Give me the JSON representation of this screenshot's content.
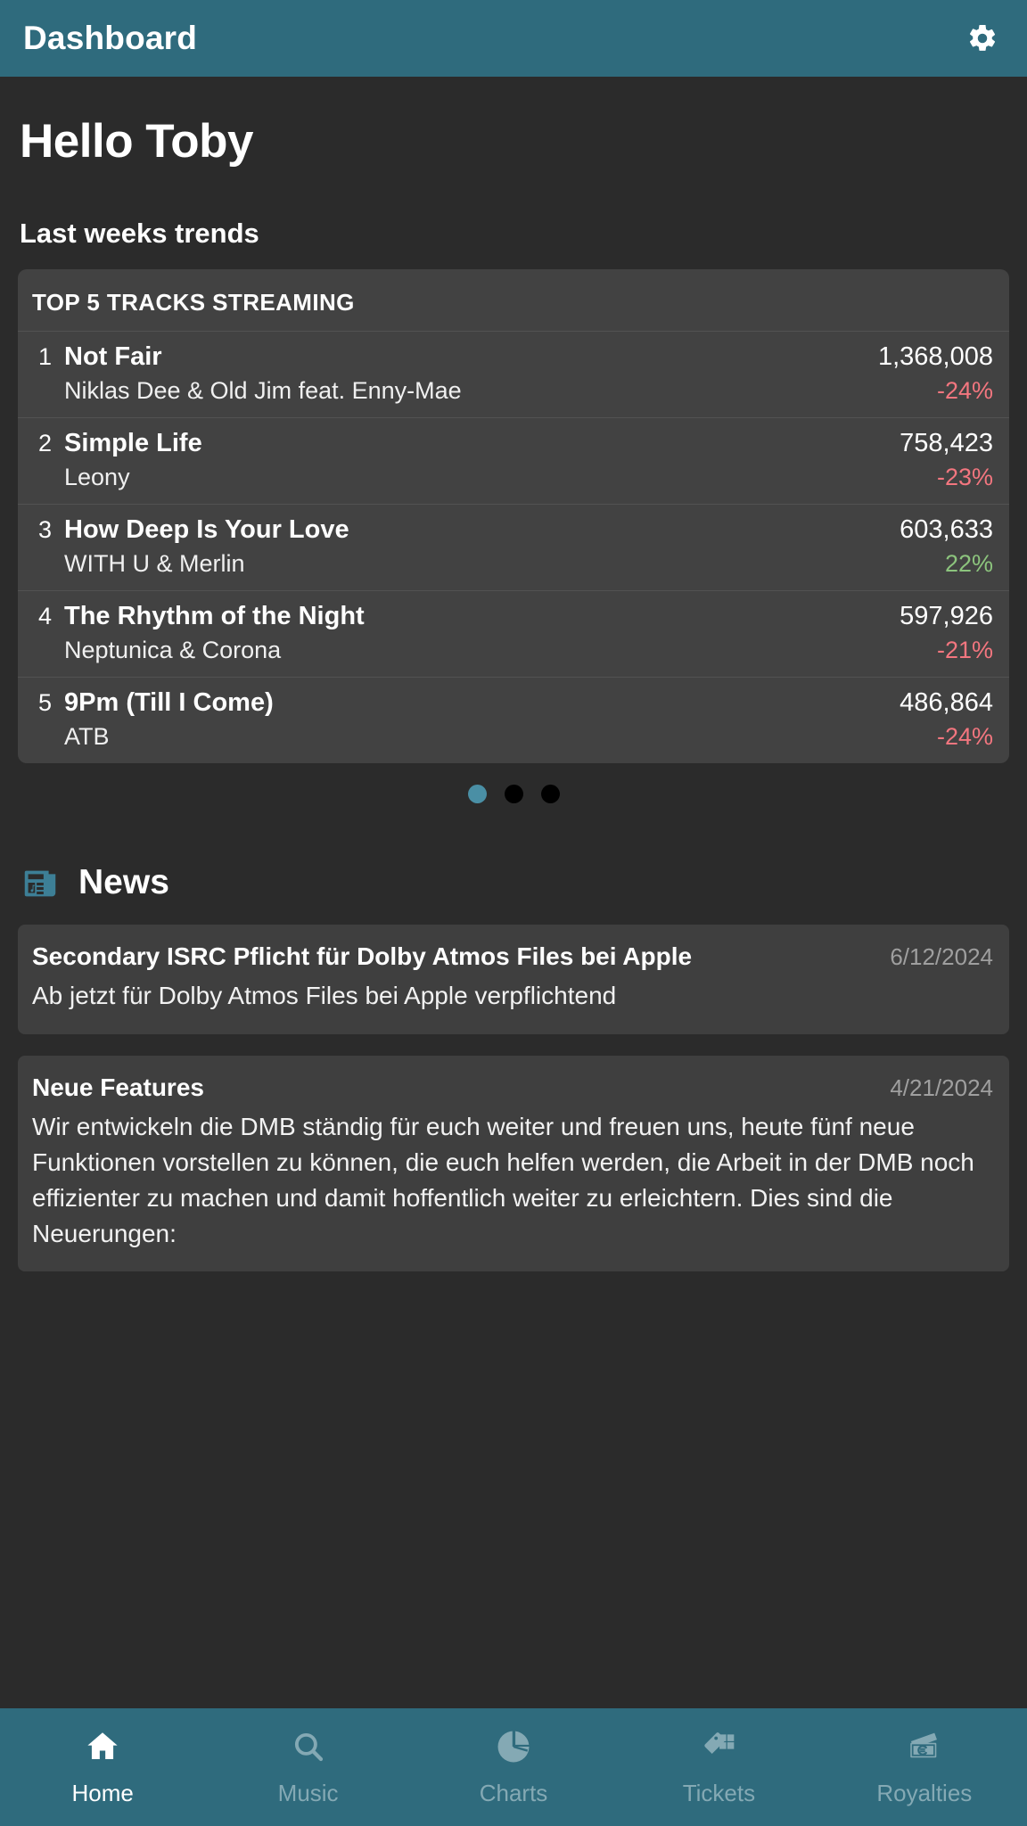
{
  "header": {
    "title": "Dashboard",
    "settings_icon": "gear-icon",
    "background_color": "#2f6b7d"
  },
  "greeting": "Hello Toby",
  "trends": {
    "section_title": "Last weeks trends",
    "card_header": "TOP 5 TRACKS STREAMING",
    "tracks": [
      {
        "rank": "1",
        "title": "Not Fair",
        "artist": "Niklas Dee & Old Jim feat. Enny-Mae",
        "streams": "1,368,008",
        "delta": "-24%",
        "direction": "neg"
      },
      {
        "rank": "2",
        "title": "Simple Life",
        "artist": "Leony",
        "streams": "758,423",
        "delta": "-23%",
        "direction": "neg"
      },
      {
        "rank": "3",
        "title": "How Deep Is Your Love",
        "artist": "WITH U & Merlin",
        "streams": "603,633",
        "delta": "22%",
        "direction": "pos"
      },
      {
        "rank": "4",
        "title": "The Rhythm of the Night",
        "artist": "Neptunica & Corona",
        "streams": "597,926",
        "delta": "-21%",
        "direction": "neg"
      },
      {
        "rank": "5",
        "title": "9Pm (Till I Come)",
        "artist": "ATB",
        "streams": "486,864",
        "delta": "-24%",
        "direction": "neg"
      }
    ],
    "pager": {
      "count": 3,
      "active_index": 0,
      "active_color": "#4a8fa5",
      "inactive_color": "#000000"
    }
  },
  "news": {
    "title": "News",
    "icon": "newspaper-icon",
    "icon_color": "#3d7f96",
    "items": [
      {
        "headline": "Secondary ISRC Pflicht für Dolby Atmos Files bei Apple",
        "date": "6/12/2024",
        "body": "Ab jetzt für Dolby Atmos Files bei Apple verpflichtend"
      },
      {
        "headline": "Neue Features",
        "date": "4/21/2024",
        "body": "Wir entwickeln die DMB ständig für euch weiter und freuen uns, heute fünf neue Funktionen vorstellen zu können, die euch helfen werden, die Arbeit in der DMB noch effizienter zu machen und damit hoffentlich weiter zu erleichtern. Dies sind die Neuerungen:"
      }
    ]
  },
  "bottom_nav": {
    "items": [
      {
        "label": "Home",
        "icon": "home-icon",
        "active": true
      },
      {
        "label": "Music",
        "icon": "search-icon",
        "active": false
      },
      {
        "label": "Charts",
        "icon": "pie-chart-icon",
        "active": false
      },
      {
        "label": "Tickets",
        "icon": "ticket-icon",
        "active": false
      },
      {
        "label": "Royalties",
        "icon": "banknote-euro-icon",
        "active": false
      }
    ],
    "active_color": "#ffffff",
    "inactive_color": "#84a9b4"
  },
  "colors": {
    "page_background": "#2b2b2b",
    "card_background": "#424242",
    "accent_teal": "#2f6b7d",
    "negative": "#f3767f",
    "positive": "#8cc47d"
  }
}
